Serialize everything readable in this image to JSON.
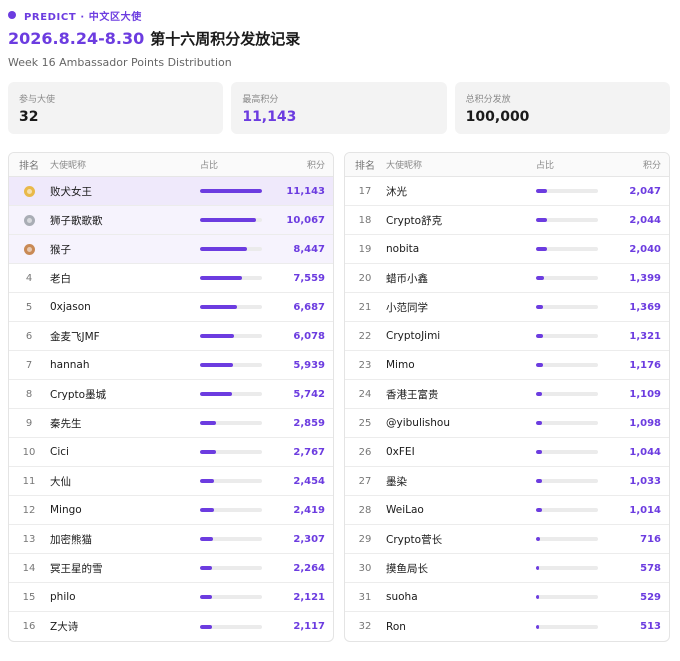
{
  "header": {
    "tag": "PREDICT · 中文区大使",
    "date_range": "2026.8.24-8.30",
    "title": "第十六周积分发放记录",
    "subtitle": "Week 16 Ambassador Points Distribution"
  },
  "stats": [
    {
      "label": "参与大使",
      "value": "32"
    },
    {
      "label": "最高积分",
      "value": "11,143"
    },
    {
      "label": "总积分发放",
      "value": "100,000"
    }
  ],
  "columns": {
    "rank": "排名",
    "name": "大使昵称",
    "share": "占比",
    "points": "积分"
  },
  "accent_color": "#6c3ce0",
  "rows_left": [
    {
      "rank": "1",
      "name": "败犬女王",
      "points": "11,143",
      "share": 1.0,
      "medal": "gold-medal-icon"
    },
    {
      "rank": "2",
      "name": "狮子歌歌歌",
      "points": "10,067",
      "share": 0.9,
      "medal": "silver-medal-icon"
    },
    {
      "rank": "3",
      "name": "猴子",
      "points": "8,447",
      "share": 0.76,
      "medal": "bronze-medal-icon"
    },
    {
      "rank": "4",
      "name": "老白",
      "points": "7,559",
      "share": 0.68
    },
    {
      "rank": "5",
      "name": "0xjason",
      "points": "6,687",
      "share": 0.6
    },
    {
      "rank": "6",
      "name": "金麦飞JMF",
      "points": "6,078",
      "share": 0.55
    },
    {
      "rank": "7",
      "name": "hannah",
      "points": "5,939",
      "share": 0.53
    },
    {
      "rank": "8",
      "name": "Crypto墨城",
      "points": "5,742",
      "share": 0.52
    },
    {
      "rank": "9",
      "name": "秦先生",
      "points": "2,859",
      "share": 0.26
    },
    {
      "rank": "10",
      "name": "Cici",
      "points": "2,767",
      "share": 0.25
    },
    {
      "rank": "11",
      "name": "大仙",
      "points": "2,454",
      "share": 0.22
    },
    {
      "rank": "12",
      "name": "Mingo",
      "points": "2,419",
      "share": 0.22
    },
    {
      "rank": "13",
      "name": "加密熊猫",
      "points": "2,307",
      "share": 0.21
    },
    {
      "rank": "14",
      "name": "冥王星的雪",
      "points": "2,264",
      "share": 0.2
    },
    {
      "rank": "15",
      "name": "philo",
      "points": "2,121",
      "share": 0.19
    },
    {
      "rank": "16",
      "name": "Z大诗",
      "points": "2,117",
      "share": 0.19
    }
  ],
  "rows_right": [
    {
      "rank": "17",
      "name": "沐光",
      "points": "2,047",
      "share": 0.18
    },
    {
      "rank": "18",
      "name": "Crypto舒克",
      "points": "2,044",
      "share": 0.18
    },
    {
      "rank": "19",
      "name": "nobita",
      "points": "2,040",
      "share": 0.18
    },
    {
      "rank": "20",
      "name": "蜡币小鑫",
      "points": "1,399",
      "share": 0.13
    },
    {
      "rank": "21",
      "name": "小范同学",
      "points": "1,369",
      "share": 0.12
    },
    {
      "rank": "22",
      "name": "CryptoJimi",
      "points": "1,321",
      "share": 0.12
    },
    {
      "rank": "23",
      "name": "Mimo",
      "points": "1,176",
      "share": 0.11
    },
    {
      "rank": "24",
      "name": "香港王富贵",
      "points": "1,109",
      "share": 0.1
    },
    {
      "rank": "25",
      "name": "@yibulishou",
      "points": "1,098",
      "share": 0.1
    },
    {
      "rank": "26",
      "name": "0xFEI",
      "points": "1,044",
      "share": 0.09
    },
    {
      "rank": "27",
      "name": "墨染",
      "points": "1,033",
      "share": 0.09
    },
    {
      "rank": "28",
      "name": "WeiLao",
      "points": "1,014",
      "share": 0.09
    },
    {
      "rank": "29",
      "name": "Crypto菅长",
      "points": "716",
      "share": 0.06
    },
    {
      "rank": "30",
      "name": "摸鱼局长",
      "points": "578",
      "share": 0.05
    },
    {
      "rank": "31",
      "name": "suoha",
      "points": "529",
      "share": 0.05
    },
    {
      "rank": "32",
      "name": "Ron",
      "points": "513",
      "share": 0.05
    }
  ]
}
